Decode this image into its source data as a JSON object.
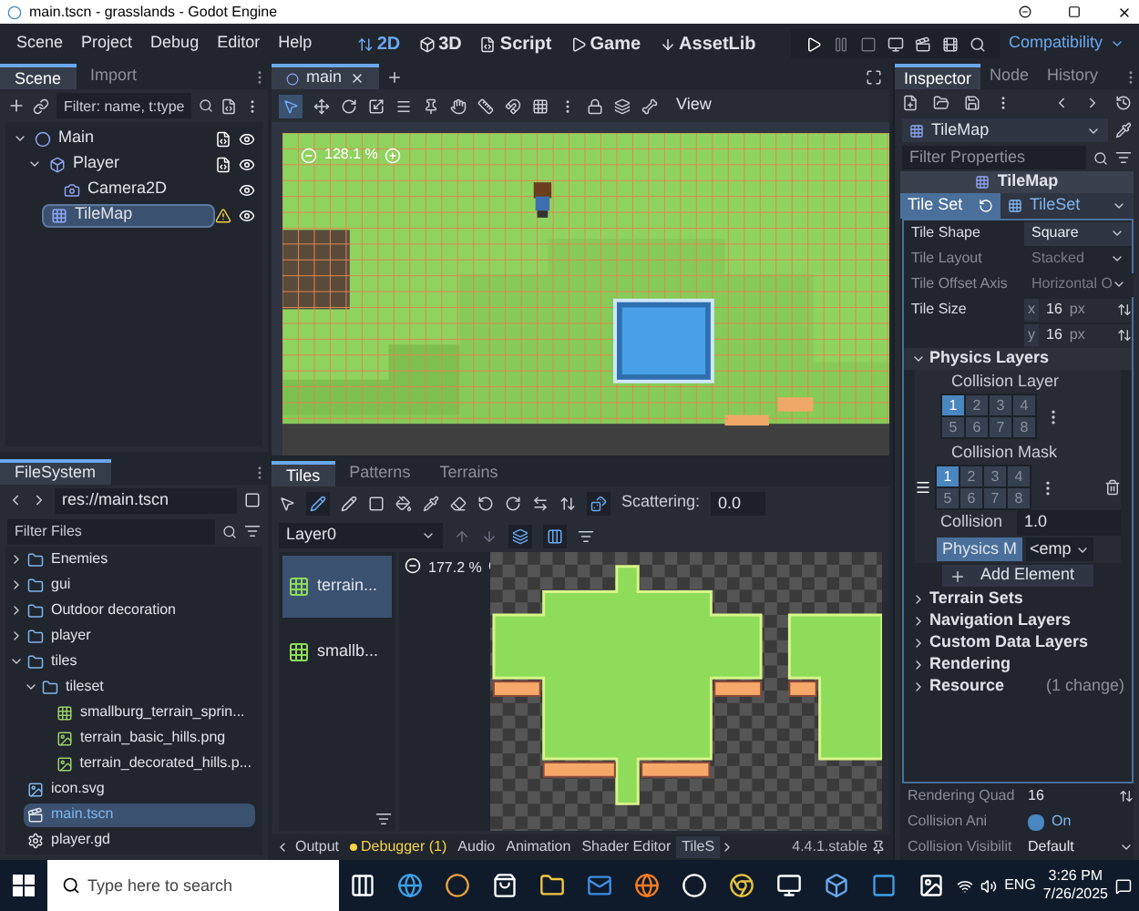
{
  "window": {
    "title": "main.tscn - grasslands - Godot Engine"
  },
  "menu": [
    "Scene",
    "Project",
    "Debug",
    "Editor",
    "Help"
  ],
  "workspaces": [
    {
      "label": "2D",
      "selected": true
    },
    {
      "label": "3D",
      "selected": false
    },
    {
      "label": "Script",
      "selected": false
    },
    {
      "label": "Game",
      "selected": false
    },
    {
      "label": "AssetLib",
      "selected": false
    }
  ],
  "renderer": "Compatibility",
  "scene_dock": {
    "tabs": [
      {
        "label": "Scene",
        "selected": true
      },
      {
        "label": "Import",
        "selected": false
      }
    ],
    "filter": {
      "placeholder": "Filter: name, t:type"
    },
    "tree": [
      {
        "name": "Main",
        "kind": "root",
        "selected": false,
        "script": true,
        "warning": false,
        "expanded": true,
        "children": [
          {
            "name": "Player",
            "kind": "body",
            "selected": false,
            "script": true,
            "warning": false,
            "expanded": true,
            "children": [
              {
                "name": "Camera2D",
                "kind": "camera",
                "selected": false,
                "script": false,
                "warning": false
              }
            ]
          },
          {
            "name": "TileMap",
            "kind": "tilemap",
            "selected": true,
            "script": false,
            "warning": true
          }
        ]
      }
    ]
  },
  "filesystem": {
    "title": "FileSystem",
    "path": "res://main.tscn",
    "filter": {
      "placeholder": "Filter Files"
    },
    "tree": [
      {
        "name": "Enemies",
        "kind": "folder",
        "expanded": false,
        "selected": false
      },
      {
        "name": "gui",
        "kind": "folder",
        "expanded": false,
        "selected": false
      },
      {
        "name": "Outdoor decoration",
        "kind": "folder",
        "expanded": false,
        "selected": false
      },
      {
        "name": "player",
        "kind": "folder",
        "expanded": false,
        "selected": false
      },
      {
        "name": "tiles",
        "kind": "folder",
        "expanded": true,
        "selected": false,
        "children": [
          {
            "name": "tileset",
            "kind": "folder",
            "expanded": true,
            "selected": false,
            "children": [
              {
                "name": "smallburg_terrain_sprin...",
                "kind": "sheet",
                "selected": false
              },
              {
                "name": "terrain_basic_hills.png",
                "kind": "image",
                "selected": false
              },
              {
                "name": "terrain_decorated_hills.p...",
                "kind": "image",
                "selected": false
              }
            ]
          }
        ]
      },
      {
        "name": "icon.svg",
        "kind": "svg",
        "selected": false
      },
      {
        "name": "main.tscn",
        "kind": "scene",
        "selected": true
      },
      {
        "name": "player.gd",
        "kind": "script",
        "selected": false
      }
    ]
  },
  "editor_tabs": [
    {
      "label": "main",
      "selected": true
    }
  ],
  "toolbar": {
    "view_menu": "View"
  },
  "viewport": {
    "zoom": "128.1 %"
  },
  "tilemap_panel": {
    "tabs": [
      {
        "label": "Tiles",
        "selected": true
      },
      {
        "label": "Patterns",
        "selected": false
      },
      {
        "label": "Terrains",
        "selected": false
      }
    ],
    "scattering_label": "Scattering:",
    "scattering": "0.0",
    "layer": "Layer0",
    "sources": [
      {
        "label": "terrain...",
        "selected": true
      },
      {
        "label": "smallb...",
        "selected": false
      }
    ],
    "zoom": "177.2 %"
  },
  "bottom_tabs": [
    {
      "label": "Output",
      "selected": false,
      "alert": false
    },
    {
      "label": "Debugger (1)",
      "selected": false,
      "alert": true
    },
    {
      "label": "Audio",
      "selected": false,
      "alert": false
    },
    {
      "label": "Animation",
      "selected": false,
      "alert": false
    },
    {
      "label": "Shader Editor",
      "selected": false,
      "alert": false
    },
    {
      "label": "TileS",
      "selected": true,
      "alert": false
    }
  ],
  "version": "4.4.1.stable",
  "inspector": {
    "tabs": [
      {
        "label": "Inspector",
        "selected": true
      },
      {
        "label": "Node",
        "selected": false
      },
      {
        "label": "History",
        "selected": false
      }
    ],
    "object": "TileMap",
    "filter": {
      "placeholder": "Filter Properties"
    },
    "header": "TileMap",
    "tile_set": {
      "label": "Tile Set",
      "value": "TileSet"
    },
    "properties": [
      {
        "label": "Tile Shape",
        "kind": "select",
        "value": "Square",
        "disabled": false
      },
      {
        "label": "Tile Layout",
        "kind": "select",
        "value": "Stacked",
        "disabled": true
      },
      {
        "label": "Tile Offset Axis",
        "kind": "select",
        "value": "Horizontal O",
        "disabled": true
      },
      {
        "label": "Tile Size",
        "kind": "vector",
        "disabled": false,
        "components": [
          {
            "axis": "x",
            "value": "16",
            "unit": "px"
          },
          {
            "axis": "y",
            "value": "16",
            "unit": "px"
          }
        ]
      }
    ],
    "physics_layers": {
      "label": "Physics Layers",
      "expanded": true,
      "collision_layer": {
        "label": "Collision Layer",
        "bits": [
          {
            "label": "1",
            "selected": true
          },
          {
            "label": "2",
            "selected": false
          },
          {
            "label": "3",
            "selected": false
          },
          {
            "label": "4",
            "selected": false
          },
          {
            "label": "5",
            "selected": false
          },
          {
            "label": "6",
            "selected": false
          },
          {
            "label": "7",
            "selected": false
          },
          {
            "label": "8",
            "selected": false
          }
        ]
      },
      "collision_mask": {
        "label": "Collision Mask",
        "bits": [
          {
            "label": "1",
            "selected": true
          },
          {
            "label": "2",
            "selected": false
          },
          {
            "label": "3",
            "selected": false
          },
          {
            "label": "4",
            "selected": false
          },
          {
            "label": "5",
            "selected": false
          },
          {
            "label": "6",
            "selected": false
          },
          {
            "label": "7",
            "selected": false
          },
          {
            "label": "8",
            "selected": false
          }
        ]
      },
      "collision": {
        "label": "Collision",
        "value": "1.0"
      },
      "physics_material": {
        "label": "Physics M",
        "value": "<emp"
      },
      "add_button": "Add Element"
    },
    "sections": [
      {
        "label": "Terrain Sets",
        "expanded": false
      },
      {
        "label": "Navigation Layers",
        "expanded": false
      },
      {
        "label": "Custom Data Layers",
        "expanded": false
      },
      {
        "label": "Rendering",
        "expanded": false
      },
      {
        "label": "Resource",
        "expanded": false,
        "note": "(1 change)"
      }
    ],
    "rendering_quadrant": {
      "label": "Rendering Quad",
      "value": "16"
    },
    "collision_animatable": {
      "label": "Collision Ani",
      "checked": true,
      "text": "On"
    },
    "collision_visibility": {
      "label": "Collision Visibilit",
      "value": "Default"
    }
  },
  "taskbar": {
    "search": {
      "placeholder": "Type here to search"
    },
    "language": "ENG",
    "time": "3:26 PM",
    "date": "7/26/2025"
  }
}
